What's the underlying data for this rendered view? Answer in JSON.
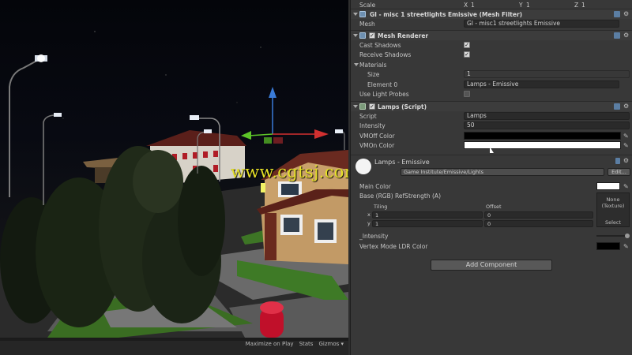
{
  "scene": {
    "bottom_options": [
      "Maximize on Play",
      "Stats",
      "Gizmos"
    ],
    "gizmos_arrow": "▾",
    "watermark": "www.cgtsj.com"
  },
  "inspector": {
    "scale_row": {
      "label": "Scale",
      "x_label": "X",
      "x": "1",
      "y_label": "Y",
      "y": "1",
      "z_label": "Z",
      "z": "1"
    },
    "mesh_filter": {
      "title": "GI - misc 1 streetlights Emissive (Mesh Filter)",
      "mesh_label": "Mesh",
      "mesh_value": "GI - misc1 streetlights Emissive"
    },
    "mesh_renderer": {
      "title": "Mesh Renderer",
      "cast_shadows_label": "Cast Shadows",
      "receive_shadows_label": "Receive Shadows",
      "materials_label": "Materials",
      "size_label": "Size",
      "size_value": "1",
      "element0_label": "Element 0",
      "element0_value": "Lamps - Emissive",
      "light_probes_label": "Use Light Probes",
      "cast_shadows": true,
      "receive_shadows": true,
      "light_probes": false
    },
    "lamps_script": {
      "title": "Lamps (Script)",
      "script_label": "Script",
      "script_value": "Lamps",
      "intensity_label": "Intensity",
      "intensity_value": "50",
      "vmoff_label": "VMOff Color",
      "vmon_label": "VMOn Color",
      "vmoff_color": "#000000",
      "vmon_color": "#ffffff"
    },
    "material": {
      "name": "Lamps - Emissive",
      "shader_label": "Shader",
      "shader_value": "Game Institute/Emissive/Lights",
      "edit_button": "Edit...",
      "main_color_label": "Main Color",
      "base_label": "Base (RGB) RefStrength (A)",
      "tiling_label": "Tiling",
      "offset_label": "Offset",
      "x_label": "x",
      "y_label": "y",
      "tiling_x": "1",
      "tiling_y": "1",
      "offset_x": "0",
      "offset_y": "0",
      "texture_none": "None (Texture)",
      "select_button": "Select",
      "intensity_label": "_Intensity",
      "vertex_mode_label": "Vertex Mode LDR Color",
      "main_color": "#ffffff",
      "vertex_color": "#000000"
    },
    "add_component_button": "Add Component"
  }
}
